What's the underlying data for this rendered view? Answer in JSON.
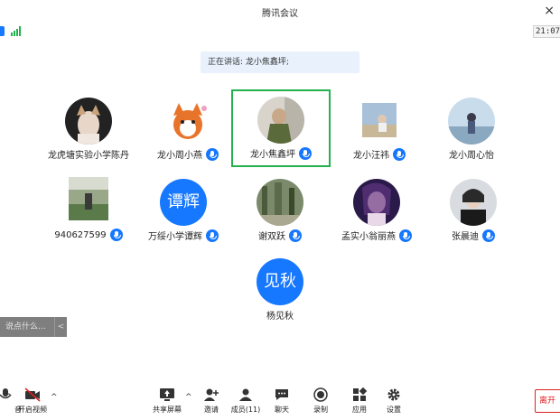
{
  "window": {
    "title": "腾讯会议",
    "close_glyph": "×"
  },
  "status": {
    "timer": "21:07"
  },
  "speaking_banner": "正在讲话: 龙小焦鑫坪;",
  "participants": [
    {
      "name": "龙虎塘实验小学陈丹",
      "mic": false
    },
    {
      "name": "龙小周小燕",
      "mic": true
    },
    {
      "name": "龙小焦鑫坪",
      "mic": true,
      "active": true
    },
    {
      "name": "龙小汪祎",
      "mic": true
    },
    {
      "name": "龙小周心怡",
      "mic": false
    },
    {
      "name": "940627599",
      "mic": true
    },
    {
      "name": "万绥小学谭辉",
      "mic": true,
      "avatar_text": "谭辉"
    },
    {
      "name": "谢双跃",
      "mic": true
    },
    {
      "name": "孟实小翁丽燕",
      "mic": true
    },
    {
      "name": "张晨迪",
      "mic": true
    },
    {
      "name": "杨见秋",
      "mic": false,
      "avatar_text": "见秋"
    }
  ],
  "chat": {
    "placeholder": "说点什么...",
    "collapse": "<"
  },
  "toolbar": {
    "mute_partial": "音",
    "video": "开启视频",
    "share": "共享屏幕",
    "invite": "邀请",
    "members": "成员(11)",
    "chat": "聊天",
    "record": "录制",
    "apps": "应用",
    "settings": "设置",
    "leave": "离开",
    "caret": "^"
  },
  "colors": {
    "accent": "#1677ff",
    "active_border": "#22b14c",
    "leave": "#e02020"
  }
}
